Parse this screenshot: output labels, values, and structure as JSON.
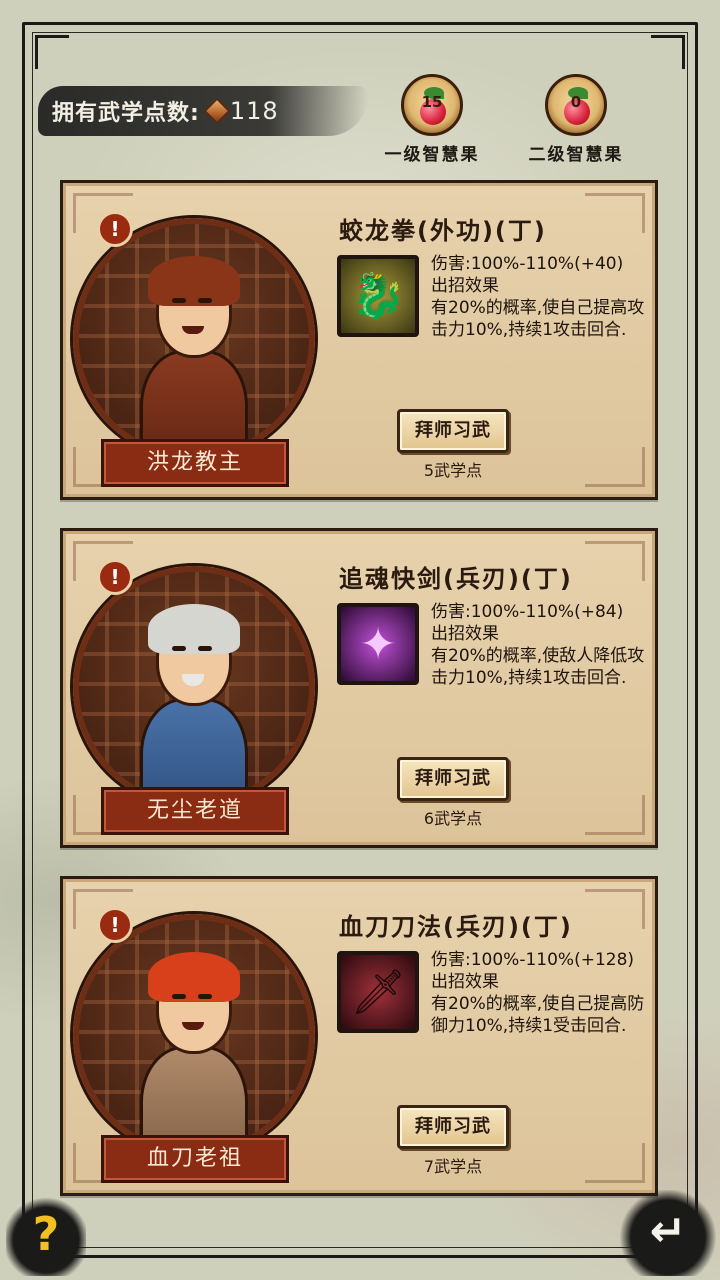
{
  "header": {
    "points_label": "拥有武学点数:",
    "points_value": "118",
    "fruits": [
      {
        "count": "15",
        "name": "一级智慧果"
      },
      {
        "count": "0",
        "name": "二级智慧果"
      }
    ]
  },
  "masters": [
    {
      "name": "洪龙教主",
      "skill_title": "蛟龙拳(外功)(丁)",
      "damage": "伤害:100%-110%(+40)",
      "effect_label": "出招效果",
      "effect_text": "有20%的概率,使自己提高攻击力10%,持续1攻击回合.",
      "button": "拜师习武",
      "cost": "5武学点",
      "icon": "dragon-icon"
    },
    {
      "name": "无尘老道",
      "skill_title": "追魂快剑(兵刃)(丁)",
      "damage": "伤害:100%-110%(+84)",
      "effect_label": "出招效果",
      "effect_text": "有20%的概率,使敌人降低攻击力10%,持续1攻击回合.",
      "button": "拜师习武",
      "cost": "6武学点",
      "icon": "sword-icon"
    },
    {
      "name": "血刀老祖",
      "skill_title": "血刀刀法(兵刃)(丁)",
      "damage": "伤害:100%-110%(+128)",
      "effect_label": "出招效果",
      "effect_text": "有20%的概率,使自己提高防御力10%,持续1受击回合.",
      "button": "拜师习武",
      "cost": "7武学点",
      "icon": "blade-icon"
    }
  ],
  "footer": {
    "help_glyph": "?",
    "back_glyph": "↵"
  },
  "colors": {
    "accent": "#8a2c14",
    "card_bg": "#e7d2ad",
    "gold": "#f2c020"
  }
}
